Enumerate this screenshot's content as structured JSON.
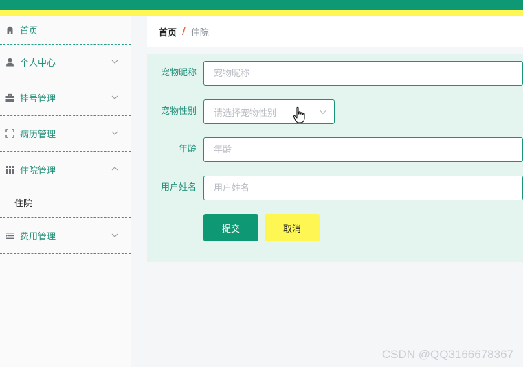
{
  "colors": {
    "primary": "#0f9874",
    "accent_yellow": "#fdf653",
    "panel_bg": "#e4f4ee"
  },
  "sidebar": {
    "items": [
      {
        "label": "首页",
        "icon": "home-icon"
      },
      {
        "label": "个人中心",
        "icon": "user-icon"
      },
      {
        "label": "挂号管理",
        "icon": "briefcase-icon"
      },
      {
        "label": "病历管理",
        "icon": "scan-icon"
      },
      {
        "label": "住院管理",
        "icon": "grid-icon",
        "expanded": true,
        "children": [
          {
            "label": "住院"
          }
        ]
      },
      {
        "label": "费用管理",
        "icon": "list-icon"
      }
    ]
  },
  "breadcrumb": {
    "home": "首页",
    "separator": "/",
    "current": "住院"
  },
  "form": {
    "nickname": {
      "label": "宠物昵称",
      "placeholder": "宠物昵称"
    },
    "gender": {
      "label": "宠物性别",
      "placeholder": "请选择宠物性别"
    },
    "age": {
      "label": "年龄",
      "placeholder": "年龄"
    },
    "username": {
      "label": "用户姓名",
      "placeholder": "用户姓名"
    },
    "submit_label": "提交",
    "cancel_label": "取消"
  },
  "watermark": "CSDN @QQ3166678367"
}
